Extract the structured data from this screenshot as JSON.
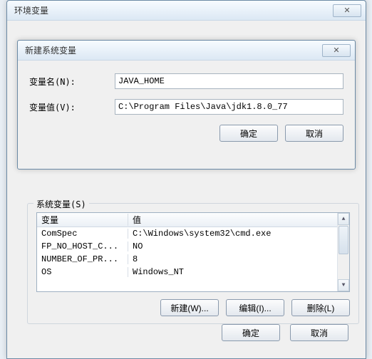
{
  "outer": {
    "title": "环境变量",
    "ok": "确定",
    "cancel": "取消"
  },
  "inner": {
    "title": "新建系统变量",
    "name_label": "变量名(N):",
    "value_label": "变量值(V):",
    "name_value": "JAVA_HOME",
    "value_value": "C:\\Program Files\\Java\\jdk1.8.0_77",
    "ok": "确定",
    "cancel": "取消"
  },
  "sysvars": {
    "legend": "系统变量(S)",
    "col_var": "变量",
    "col_val": "值",
    "rows": [
      {
        "var": "ComSpec",
        "val": "C:\\Windows\\system32\\cmd.exe"
      },
      {
        "var": "FP_NO_HOST_C...",
        "val": "NO"
      },
      {
        "var": "NUMBER_OF_PR...",
        "val": "8"
      },
      {
        "var": "OS",
        "val": "Windows_NT"
      }
    ],
    "new_btn": "新建(W)...",
    "edit_btn": "编辑(I)...",
    "delete_btn": "删除(L)"
  }
}
